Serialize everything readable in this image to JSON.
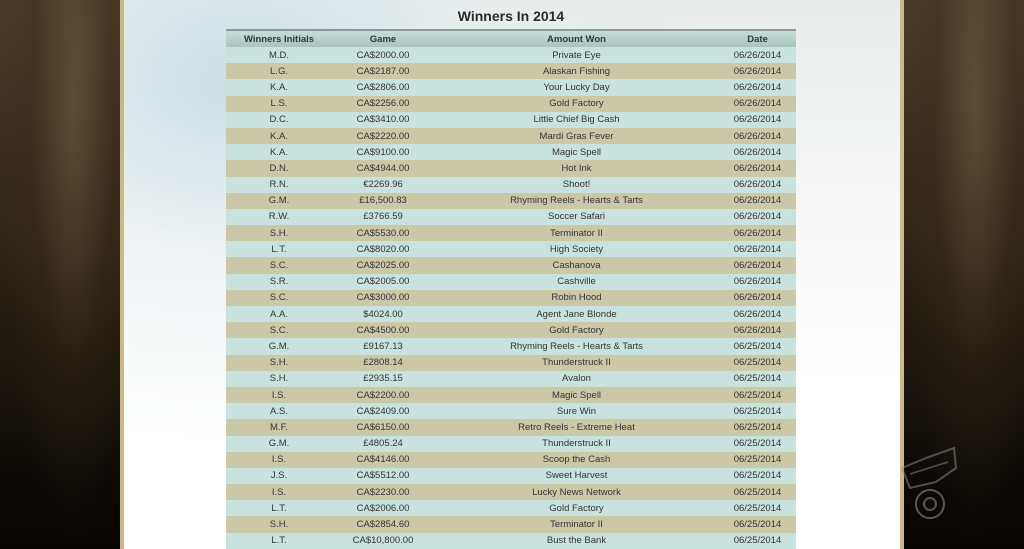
{
  "page": {
    "title": "Winners In 2014"
  },
  "table": {
    "headers": [
      "Winners Initials",
      "Game",
      "Amount Won",
      "Date"
    ],
    "rows": [
      [
        "M.D.",
        "CA$2000.00",
        "Private Eye",
        "06/26/2014"
      ],
      [
        "L.G.",
        "CA$2187.00",
        "Alaskan Fishing",
        "06/26/2014"
      ],
      [
        "K.A.",
        "CA$2806.00",
        "Your Lucky Day",
        "06/26/2014"
      ],
      [
        "L.S.",
        "CA$2256.00",
        "Gold Factory",
        "06/26/2014"
      ],
      [
        "D.C.",
        "CA$3410.00",
        "Little Chief Big Cash",
        "06/26/2014"
      ],
      [
        "K.A.",
        "CA$2220.00",
        "Mardi Gras Fever",
        "06/26/2014"
      ],
      [
        "K.A.",
        "CA$9100.00",
        "Magic Spell",
        "06/26/2014"
      ],
      [
        "D.N.",
        "CA$4944.00",
        "Hot Ink",
        "06/26/2014"
      ],
      [
        "R.N.",
        "€2269.96",
        "Shoot!",
        "06/26/2014"
      ],
      [
        "G.M.",
        "£16,500.83",
        "Rhyming Reels - Hearts & Tarts",
        "06/26/2014"
      ],
      [
        "R.W.",
        "£3766.59",
        "Soccer Safari",
        "06/26/2014"
      ],
      [
        "S.H.",
        "CA$5530.00",
        "Terminator II",
        "06/26/2014"
      ],
      [
        "L.T.",
        "CA$8020.00",
        "High Society",
        "06/26/2014"
      ],
      [
        "S.C.",
        "CA$2025.00",
        "Cashanova",
        "06/26/2014"
      ],
      [
        "S.R.",
        "CA$2005.00",
        "Cashville",
        "06/26/2014"
      ],
      [
        "S.C.",
        "CA$3000.00",
        "Robin Hood",
        "06/26/2014"
      ],
      [
        "A.A.",
        "$4024.00",
        "Agent Jane Blonde",
        "06/26/2014"
      ],
      [
        "S.C.",
        "CA$4500.00",
        "Gold Factory",
        "06/26/2014"
      ],
      [
        "G.M.",
        "£9167.13",
        "Rhyming Reels - Hearts & Tarts",
        "06/25/2014"
      ],
      [
        "S.H.",
        "£2808.14",
        "Thunderstruck II",
        "06/25/2014"
      ],
      [
        "S.H.",
        "£2935.15",
        "Avalon",
        "06/25/2014"
      ],
      [
        "I.S.",
        "CA$2200.00",
        "Magic Spell",
        "06/25/2014"
      ],
      [
        "A.S.",
        "CA$2409.00",
        "Sure Win",
        "06/25/2014"
      ],
      [
        "M.F.",
        "CA$6150.00",
        "Retro Reels - Extreme Heat",
        "06/25/2014"
      ],
      [
        "G.M.",
        "£4805.24",
        "Thunderstruck II",
        "06/25/2014"
      ],
      [
        "I.S.",
        "CA$4146.00",
        "Scoop the Cash",
        "06/25/2014"
      ],
      [
        "J.S.",
        "CA$5512.00",
        "Sweet Harvest",
        "06/25/2014"
      ],
      [
        "I.S.",
        "CA$2230.00",
        "Lucky News Network",
        "06/25/2014"
      ],
      [
        "L.T.",
        "CA$2006.00",
        "Gold Factory",
        "06/25/2014"
      ],
      [
        "S.H.",
        "CA$2854.60",
        "Terminator II",
        "06/25/2014"
      ],
      [
        "L.T.",
        "CA$10,800.00",
        "Bust the Bank",
        "06/25/2014"
      ]
    ]
  }
}
